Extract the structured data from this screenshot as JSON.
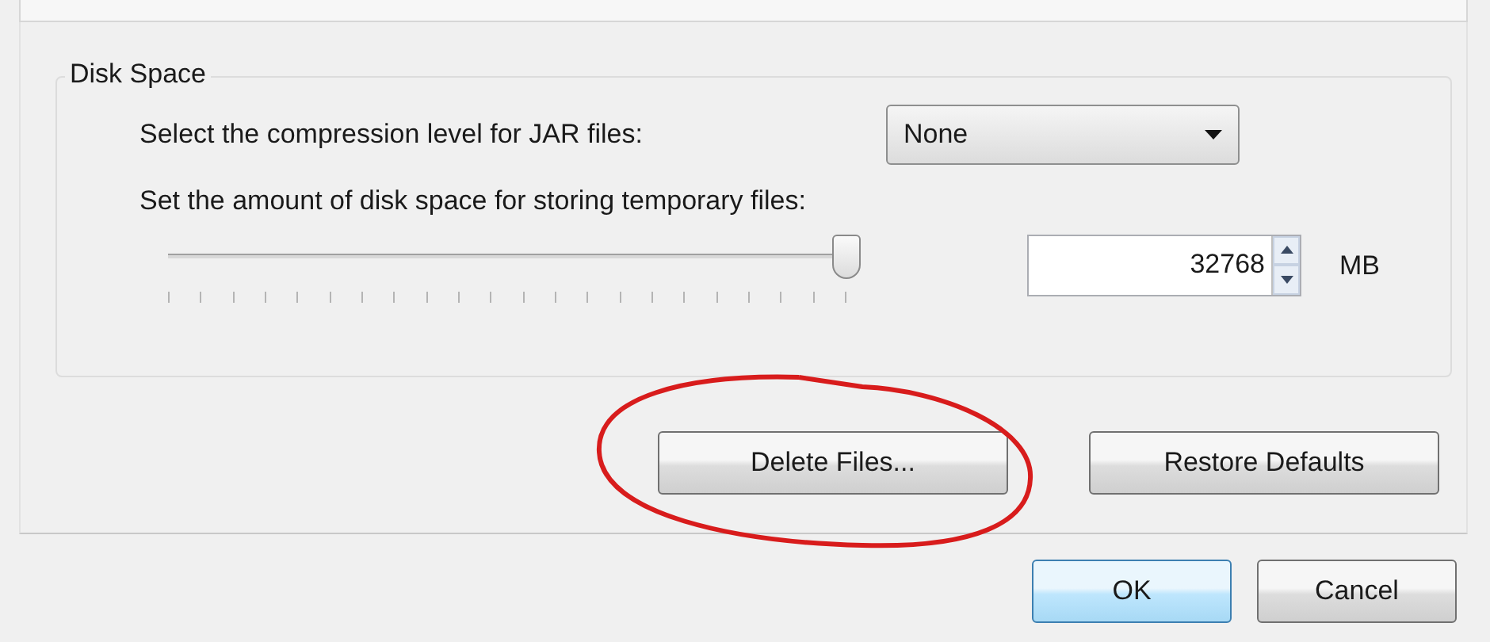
{
  "group": {
    "title": "Disk Space"
  },
  "compression": {
    "label": "Select the compression level for JAR files:",
    "value": "None"
  },
  "temp_space": {
    "label": "Set the amount of disk space for storing temporary files:",
    "level": 1.0,
    "value": "32768",
    "unit": "MB"
  },
  "group_buttons": [
    {
      "label": "Delete Files...",
      "annotated": true
    },
    {
      "label": "Restore Defaults",
      "annotated": false
    }
  ],
  "dialog_buttons": [
    {
      "label": "OK",
      "default": true
    },
    {
      "label": "Cancel",
      "default": false
    }
  ]
}
